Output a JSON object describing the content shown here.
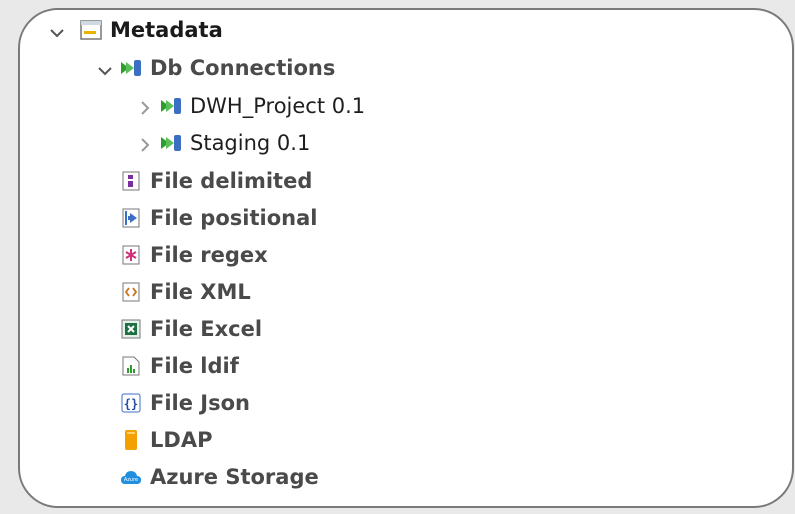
{
  "tree": {
    "root": {
      "label": "Metadata",
      "icon": "metadata-folder-icon",
      "expanded": true
    },
    "db_connections": {
      "label": "Db Connections",
      "icon": "db-connections-icon",
      "expanded": true
    },
    "connections": [
      {
        "label": "DWH_Project 0.1",
        "icon": "db-connection-icon"
      },
      {
        "label": "Staging 0.1",
        "icon": "db-connection-icon"
      }
    ],
    "items": [
      {
        "label": "File delimited",
        "icon": "file-delimited-icon"
      },
      {
        "label": "File positional",
        "icon": "file-positional-icon"
      },
      {
        "label": "File regex",
        "icon": "file-regex-icon"
      },
      {
        "label": "File XML",
        "icon": "file-xml-icon"
      },
      {
        "label": "File Excel",
        "icon": "file-excel-icon"
      },
      {
        "label": "File ldif",
        "icon": "file-ldif-icon"
      },
      {
        "label": "File Json",
        "icon": "file-json-icon"
      },
      {
        "label": "LDAP",
        "icon": "ldap-icon"
      },
      {
        "label": "Azure Storage",
        "icon": "azure-storage-icon"
      }
    ]
  },
  "colors": {
    "db_green": "#2e9c2e",
    "db_blue": "#3b6fc4",
    "folder_yellow": "#e8b400",
    "ldap_orange": "#f2a100",
    "azure_blue": "#1f8fe0",
    "excel_green": "#1d6f42",
    "regex_pink": "#d0307a"
  }
}
